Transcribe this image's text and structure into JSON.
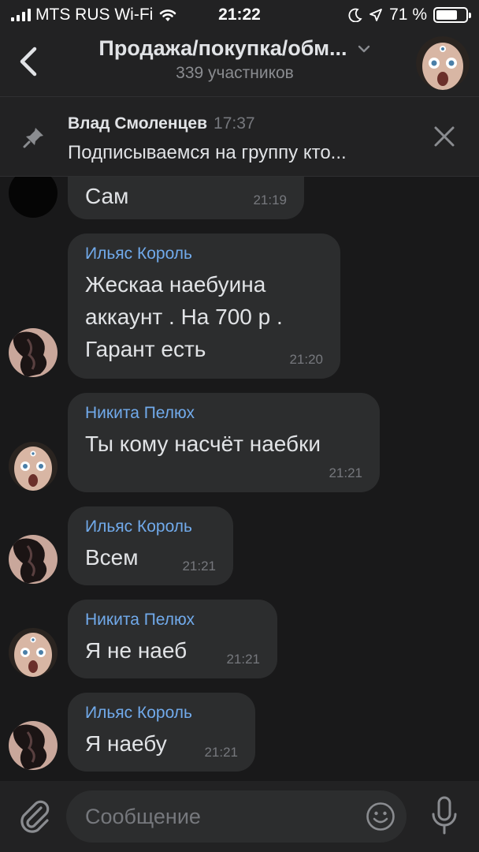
{
  "status": {
    "carrier": "MTS RUS Wi-Fi",
    "time": "21:22",
    "battery": "71 %",
    "battery_level": 0.71
  },
  "header": {
    "title": "Продажа/покупка/обм...",
    "subtitle": "339 участников"
  },
  "pinned": {
    "author": "Влад Смоленцев",
    "time": "17:37",
    "text": "Подписываемся на группу кто..."
  },
  "messages": [
    {
      "author": "",
      "text": "Сам",
      "time": "21:19"
    },
    {
      "author": "Ильяс Король",
      "text": "Жескаа наебуина аккаунт . На 700 р . Гарант есть",
      "time": "21:20"
    },
    {
      "author": "Никита Пелюх",
      "text": "Ты кому насчёт наебки",
      "time": "21:21"
    },
    {
      "author": "Ильяс Король",
      "text": "Всем",
      "time": "21:21"
    },
    {
      "author": "Никита Пелюх",
      "text": "Я не наеб",
      "time": "21:21"
    },
    {
      "author": "Ильяс Король",
      "text": "Я наебу",
      "time": "21:21"
    }
  ],
  "composer": {
    "placeholder": "Сообщение"
  },
  "icons": {
    "back": "chevron-left-icon",
    "dropdown": "chevron-down-icon",
    "pin": "pin-icon",
    "close": "close-icon",
    "attach": "paperclip-icon",
    "emoji": "smile-icon",
    "mic": "microphone-icon"
  },
  "colors": {
    "background": "#19191a",
    "bubble": "#2c2d2e",
    "author": "#71aaeb",
    "text": "#e1e3e6",
    "meta": "#76787d"
  }
}
